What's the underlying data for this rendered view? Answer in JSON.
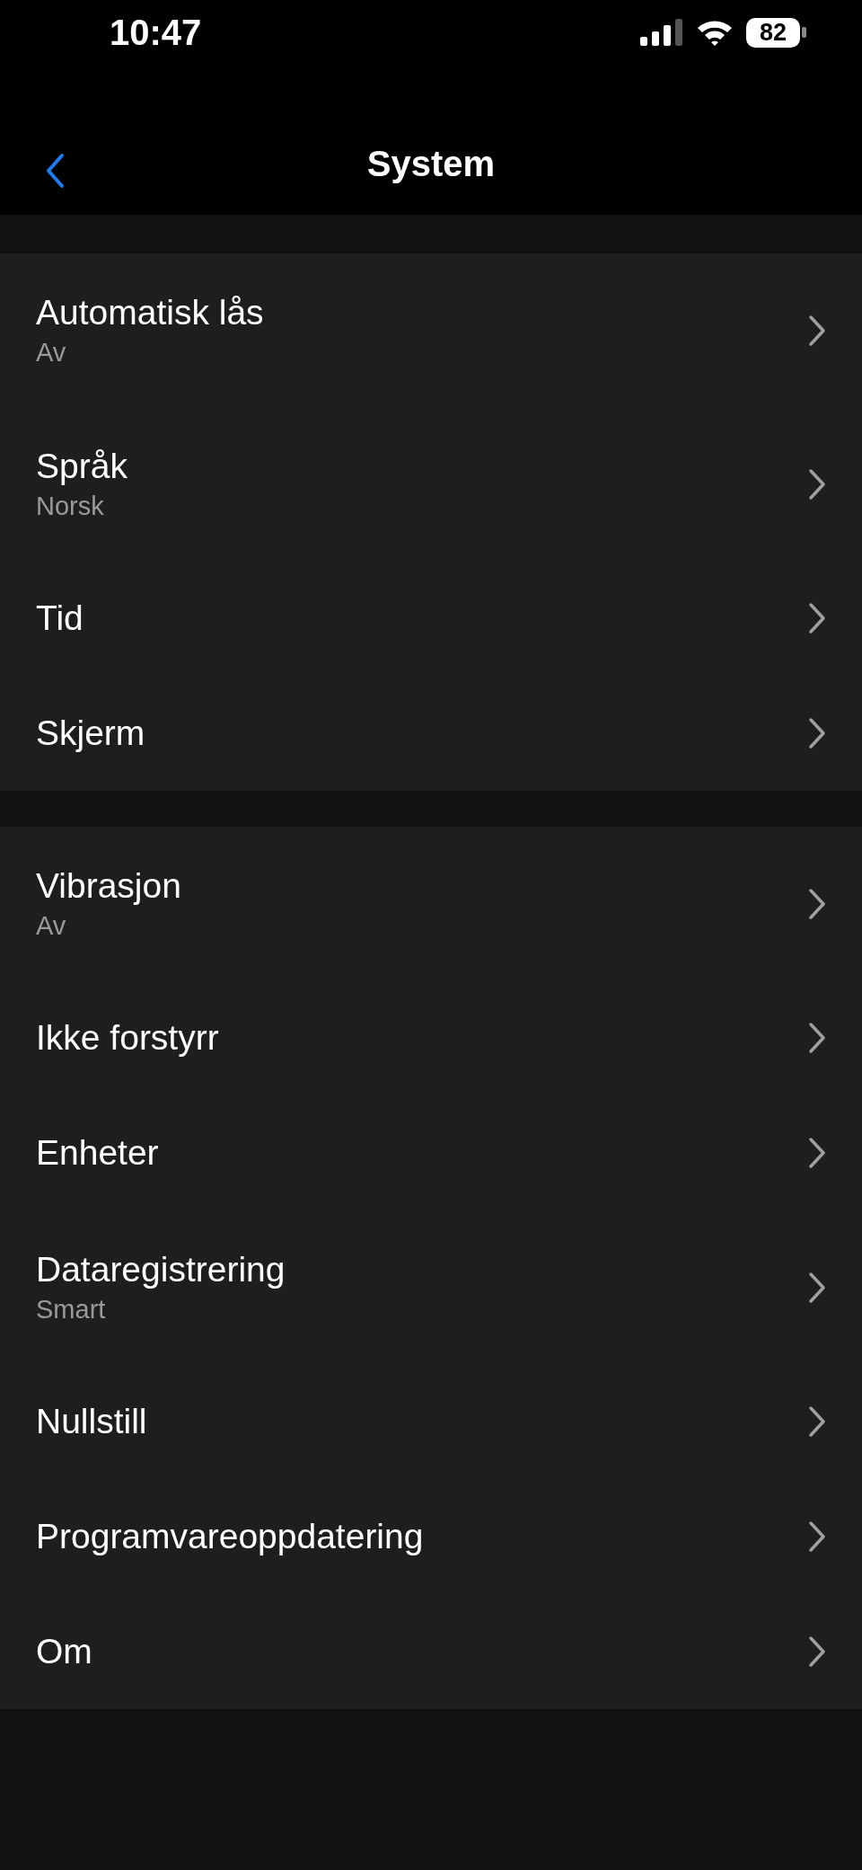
{
  "status_bar": {
    "time": "10:47",
    "battery": "82"
  },
  "nav": {
    "title": "System"
  },
  "groups": [
    {
      "items": [
        {
          "label": "Automatisk lås",
          "value": "Av"
        },
        {
          "label": "Språk",
          "value": "Norsk"
        },
        {
          "label": "Tid"
        },
        {
          "label": "Skjerm"
        }
      ]
    },
    {
      "items": [
        {
          "label": "Vibrasjon",
          "value": "Av"
        },
        {
          "label": "Ikke forstyrr"
        },
        {
          "label": "Enheter"
        },
        {
          "label": "Dataregistrering",
          "value": "Smart"
        },
        {
          "label": "Nullstill"
        },
        {
          "label": "Programvareoppdatering"
        },
        {
          "label": "Om"
        }
      ]
    }
  ]
}
